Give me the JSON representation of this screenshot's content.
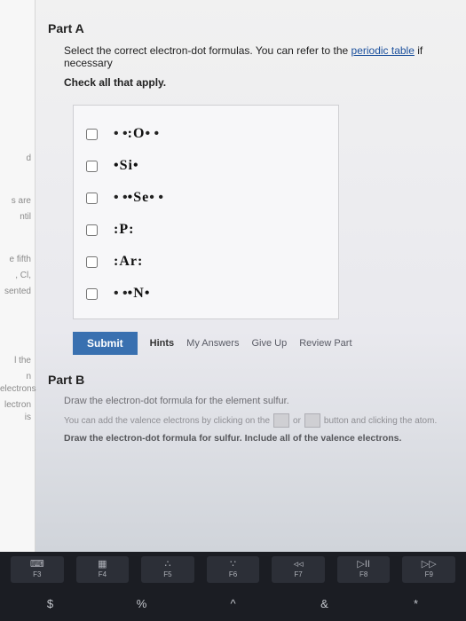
{
  "leftNav": {
    "fragments": [
      "d",
      "s are",
      "ntil",
      "",
      "e fifth",
      ", Cl,",
      "sented",
      "",
      "l the",
      "n electrons",
      "lectron is"
    ]
  },
  "partA": {
    "title": "Part A",
    "prompt_before": "Select the correct electron-dot formulas. You can refer to the ",
    "link_text": "periodic table",
    "prompt_after": " if necessary",
    "check_all": "Check all that apply.",
    "options": [
      {
        "symbol": "O",
        "dots_top": "• •",
        "left": ":",
        "right": "",
        "dots_bot": "• •"
      },
      {
        "symbol": "Si",
        "dots_top": "",
        "left": "•",
        "right": "•",
        "dots_bot": ""
      },
      {
        "symbol": "Se",
        "dots_top": "• •",
        "left": "•",
        "right": "",
        "dots_bot": "• •"
      },
      {
        "symbol": "P",
        "dots_top": "",
        "left": ":",
        "right": ":",
        "dots_bot": ""
      },
      {
        "symbol": "Ar",
        "dots_top": "",
        "left": ":",
        "right": ":",
        "dots_bot": ""
      },
      {
        "symbol": "N",
        "dots_top": "• •",
        "left": "•",
        "right": "•",
        "dots_bot": ""
      }
    ],
    "buttons": {
      "submit": "Submit",
      "hints": "Hints",
      "my_answers": "My Answers",
      "give_up": "Give Up",
      "review": "Review Part"
    }
  },
  "partB": {
    "title": "Part B",
    "line1": "Draw the electron-dot formula for the element sulfur.",
    "line2_a": "You can add the valence electrons by clicking on the",
    "line2_b": "or",
    "line2_c": "button and clicking the atom.",
    "line3": "Draw the electron-dot formula for sulfur. Include all of the valence electrons."
  },
  "keyboard": {
    "fn": [
      {
        "glyph": "⌨",
        "label": "F3",
        "glyph2": ""
      },
      {
        "glyph": "▦",
        "label": "F4",
        "glyph2": ""
      },
      {
        "glyph": "∴",
        "label": "F5",
        "glyph2": ""
      },
      {
        "glyph": "∵",
        "label": "F6",
        "glyph2": ""
      },
      {
        "glyph": "◃◃",
        "label": "F7",
        "glyph2": ""
      },
      {
        "glyph": "▷II",
        "label": "F8",
        "glyph2": ""
      },
      {
        "glyph": "▷▷",
        "label": "F9",
        "glyph2": ""
      }
    ],
    "sym": [
      "$",
      "%",
      "^",
      "&",
      "*"
    ]
  }
}
